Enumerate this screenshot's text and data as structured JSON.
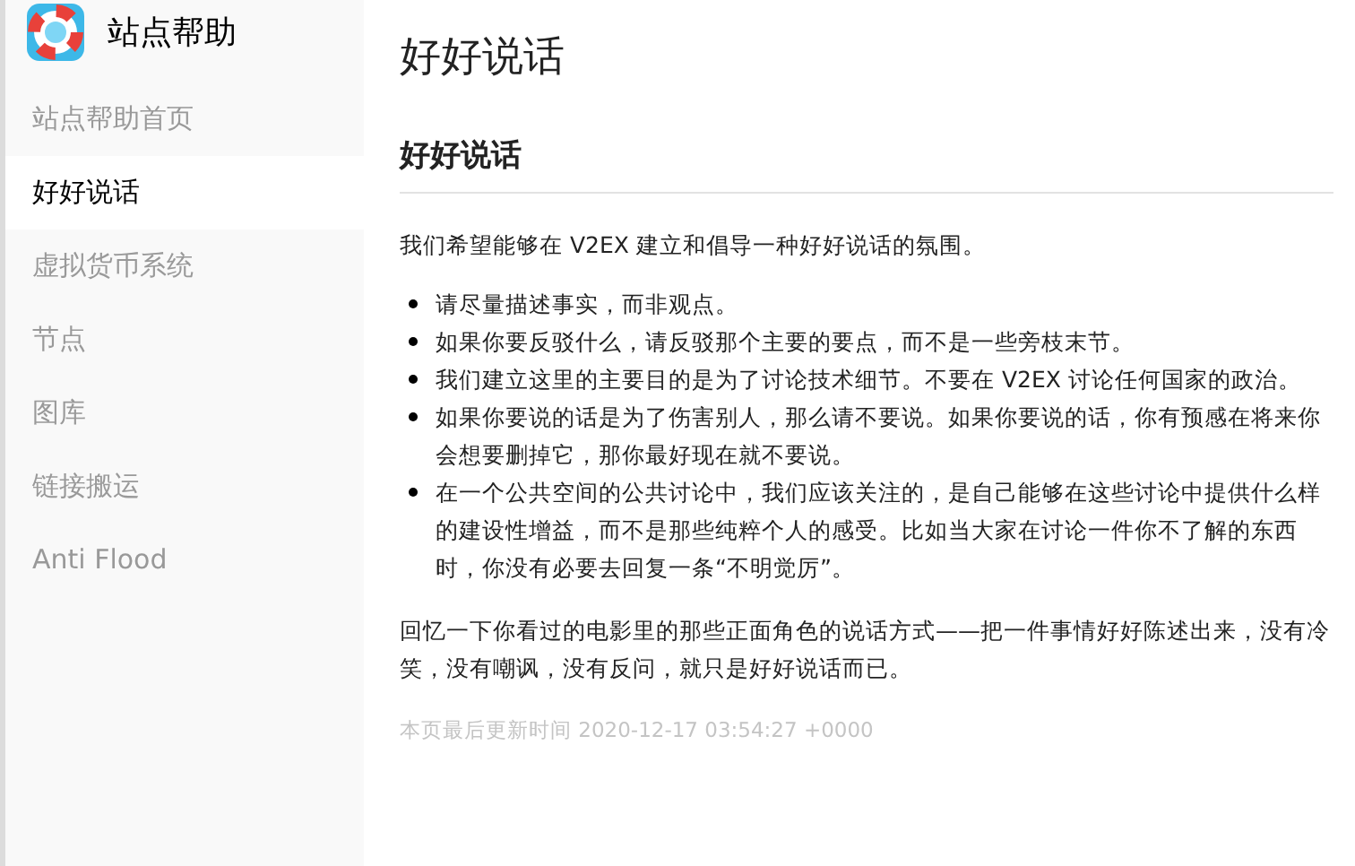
{
  "sidebar": {
    "title": "站点帮助",
    "items": [
      {
        "label": "站点帮助首页",
        "selected": false
      },
      {
        "label": "好好说话",
        "selected": true
      },
      {
        "label": "虚拟货币系统",
        "selected": false
      },
      {
        "label": "节点",
        "selected": false
      },
      {
        "label": "图库",
        "selected": false
      },
      {
        "label": "链接搬运",
        "selected": false
      },
      {
        "label": "Anti Flood",
        "selected": false
      }
    ]
  },
  "page": {
    "title": "好好说话",
    "section_title": "好好说话",
    "intro": "我们希望能够在 V2EX 建立和倡导一种好好说话的氛围。",
    "bullets": [
      "请尽量描述事实，而非观点。",
      "如果你要反驳什么，请反驳那个主要的要点，而不是一些旁枝末节。",
      "我们建立这里的主要目的是为了讨论技术细节。不要在 V2EX 讨论任何国家的政治。",
      "如果你要说的话是为了伤害别人，那么请不要说。如果你要说的话，你有预感在将来你会想要删掉它，那你最好现在就不要说。",
      "在一个公共空间的公共讨论中，我们应该关注的，是自己能够在这些讨论中提供什么样的建设性增益，而不是那些纯粹个人的感受。比如当大家在讨论一件你不了解的东西时，你没有必要去回复一条“不明觉厉”。"
    ],
    "closing": "回忆一下你看过的电影里的那些正面角色的说话方式——把一件事情好好陈述出来，没有冷笑，没有嘲讽，没有反问，就只是好好说话而已。",
    "updated": "本页最后更新时间 2020-12-17 03:54:27 +0000"
  }
}
